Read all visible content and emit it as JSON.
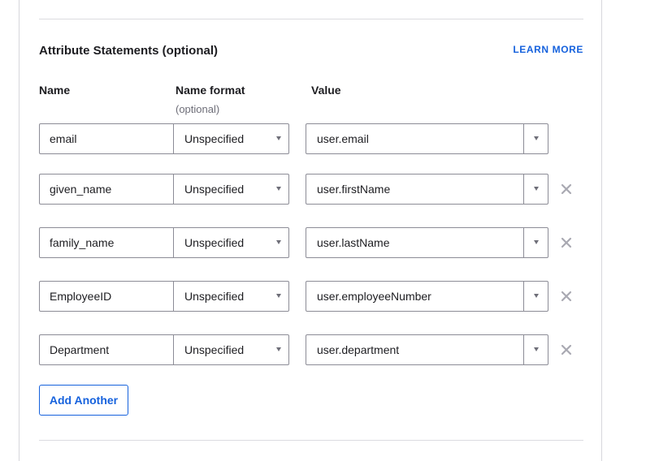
{
  "section": {
    "title": "Attribute Statements (optional)",
    "learn_more": "LEARN MORE"
  },
  "columns": {
    "name": "Name",
    "name_format": "Name format",
    "name_format_sub": "(optional)",
    "value": "Value"
  },
  "rows": [
    {
      "name": "email",
      "format": "Unspecified",
      "value": "user.email",
      "removable": false
    },
    {
      "name": "given_name",
      "format": "Unspecified",
      "value": "user.firstName",
      "removable": true
    },
    {
      "name": "family_name",
      "format": "Unspecified",
      "value": "user.lastName",
      "removable": true
    },
    {
      "name": "EmployeeID",
      "format": "Unspecified",
      "value": "user.employeeNumber",
      "removable": true
    },
    {
      "name": "Department",
      "format": "Unspecified",
      "value": "user.department",
      "removable": true
    }
  ],
  "icons": {
    "remove": "close-icon",
    "dropdown": "chevron-down-icon"
  },
  "colors": {
    "accent": "#1662dd",
    "border": "#8c8c96",
    "remove_icon": "#a9a9b2"
  },
  "add_button": {
    "label": "Add Another"
  }
}
